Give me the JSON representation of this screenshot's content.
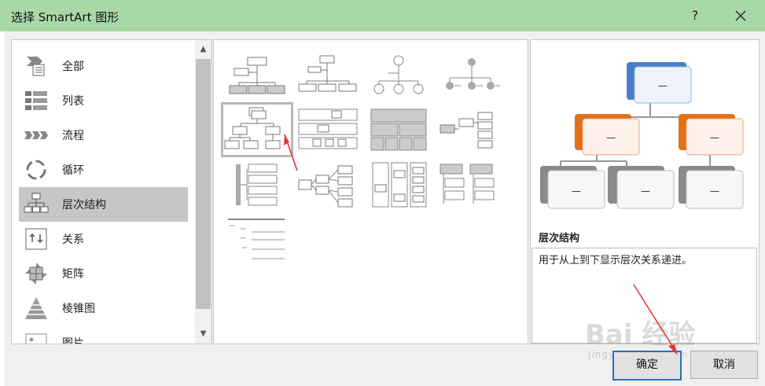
{
  "window": {
    "title": "选择 SmartArt 图形",
    "help_label": "?",
    "close_icon": "close-icon"
  },
  "categories": [
    {
      "label": "全部",
      "icon": "all-icon"
    },
    {
      "label": "列表",
      "icon": "list-icon"
    },
    {
      "label": "流程",
      "icon": "process-icon"
    },
    {
      "label": "循环",
      "icon": "cycle-icon"
    },
    {
      "label": "层次结构",
      "icon": "hierarchy-icon",
      "selected": true
    },
    {
      "label": "关系",
      "icon": "relationship-icon"
    },
    {
      "label": "矩阵",
      "icon": "matrix-icon"
    },
    {
      "label": "棱锥图",
      "icon": "pyramid-icon"
    },
    {
      "label": "图片",
      "icon": "picture-icon"
    }
  ],
  "gallery": {
    "selected_index": 4,
    "layouts": [
      "org-chart",
      "name-title-org-chart",
      "half-circle-org-chart",
      "circle-picture-hierarchy",
      "hierarchy",
      "labeled-hierarchy",
      "table-hierarchy",
      "horizontal-hierarchy",
      "hierarchy-list",
      "horizontal-multi-level",
      "architecture-layout",
      "lined-list",
      "hierarchy-lines"
    ]
  },
  "preview": {
    "name": "层次结构",
    "description": "用于从上到下显示层次关系递进。",
    "node_text": "—"
  },
  "buttons": {
    "ok": "确定",
    "cancel": "取消"
  },
  "watermark": {
    "brand": "Bai 经验",
    "url": "jingyan.baidu.com"
  },
  "colors": {
    "titlebar": "#a8d8a8",
    "node_blue": "#4a7fc8",
    "node_orange": "#e0701a",
    "node_gray": "#8a8a8a",
    "ok_border": "#2a6ebd"
  }
}
